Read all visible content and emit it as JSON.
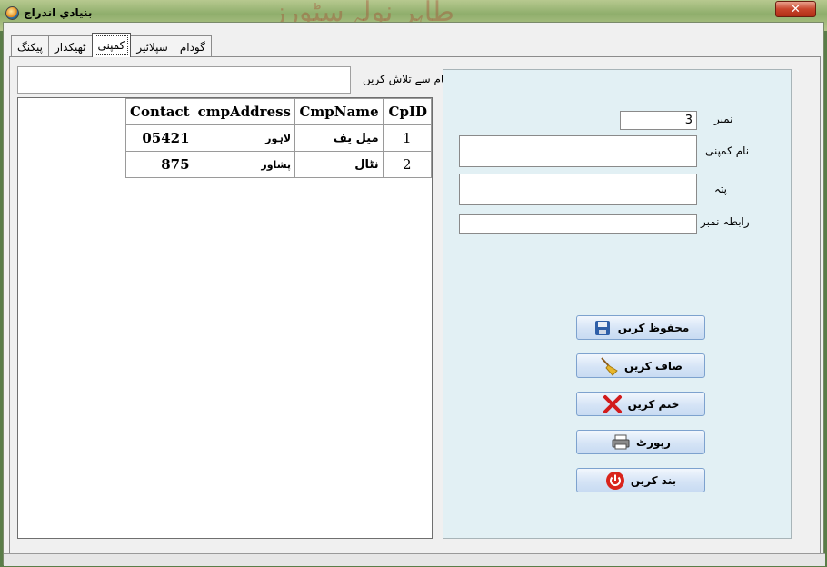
{
  "window": {
    "title": "بنيادي اندراج",
    "close_label": "✕"
  },
  "tabs": [
    {
      "label": "پیکنگ"
    },
    {
      "label": "ٹھیکدار"
    },
    {
      "label": "کمپنی"
    },
    {
      "label": "سپلائیر"
    },
    {
      "label": "گودام"
    }
  ],
  "search": {
    "label": "نام سے تلاش کریں",
    "value": ""
  },
  "grid": {
    "columns": [
      "Contact",
      "cmpAddress",
      "CmpName",
      "CpID"
    ],
    "rows": [
      {
        "contact": "05421",
        "address": "لاہور",
        "name": "میل یف",
        "id": "1"
      },
      {
        "contact": "875",
        "address": "پشاور",
        "name": "نٹال",
        "id": "2"
      }
    ]
  },
  "form": {
    "number_label": "نمبر",
    "number_value": "3",
    "company_name_label": "نام کمپنی",
    "company_name_value": "",
    "address_label": "پتہ",
    "address_value": "",
    "contact_label": "رابطہ نمبر",
    "contact_value": ""
  },
  "buttons": {
    "save": "محفوظ کریں",
    "clear": "صاف کریں",
    "delete": "ختم کریں",
    "report": "رپورٹ",
    "close": "بند کریں"
  }
}
